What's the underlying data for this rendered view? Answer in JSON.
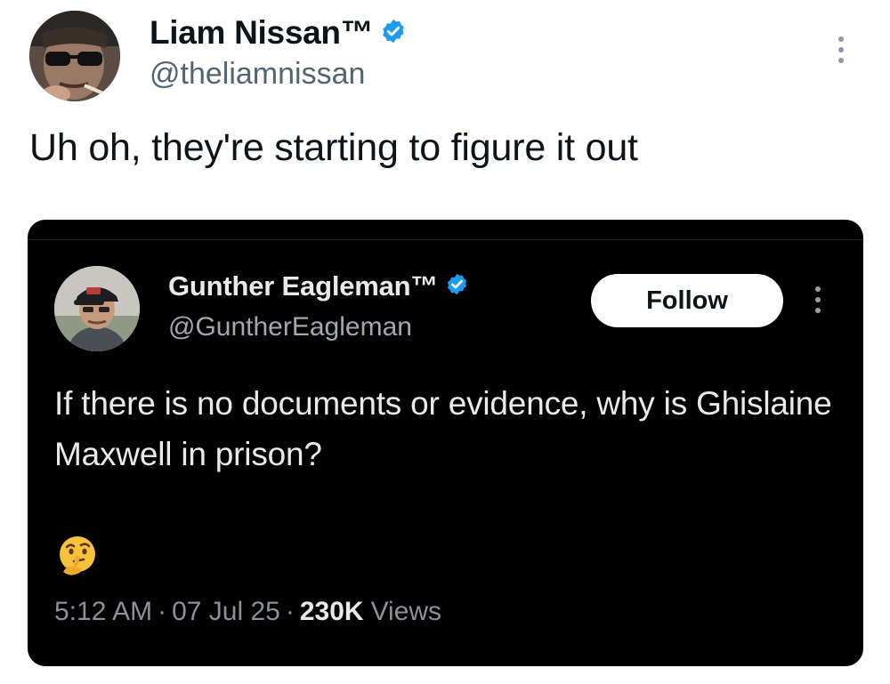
{
  "outer_tweet": {
    "author_name": "Liam Nissan™",
    "handle": "@theliamnissan",
    "text": "Uh oh, they're starting to figure it out"
  },
  "quoted_tweet": {
    "author_name": "Gunther Eagleman™",
    "handle": "@GuntherEagleman",
    "follow_label": "Follow",
    "text": "If there is no documents or evidence, why is Ghislaine Maxwell in prison?",
    "emoji": "🤔",
    "time": "5:12 AM",
    "separator": "·",
    "date": "07 Jul 25",
    "views_count": "230K",
    "views_label": "Views"
  },
  "icons": {
    "verified": "verified-badge-icon",
    "more": "more-options-icon",
    "emoji": "thinking-face-icon"
  },
  "colors": {
    "verified_blue": "#1d9bf0",
    "text_dark": "#0f1419",
    "text_gray": "#536471",
    "card_bg": "#000000"
  }
}
